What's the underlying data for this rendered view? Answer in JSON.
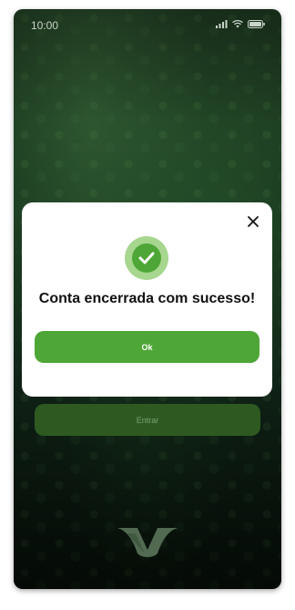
{
  "status_bar": {
    "time": "10:00",
    "icons": [
      "signal-icon",
      "wifi-icon",
      "battery-icon"
    ]
  },
  "background": {
    "entrar_label": "Entrar",
    "logo": "brand-logo"
  },
  "modal": {
    "title": "Conta encerrada com sucesso!",
    "ok_label": "Ok",
    "icons": [
      "close-icon",
      "check-icon"
    ]
  },
  "colors": {
    "primary_green": "#4ea636",
    "light_green": "#a7d68f",
    "dark_button": "#2e5a22"
  }
}
